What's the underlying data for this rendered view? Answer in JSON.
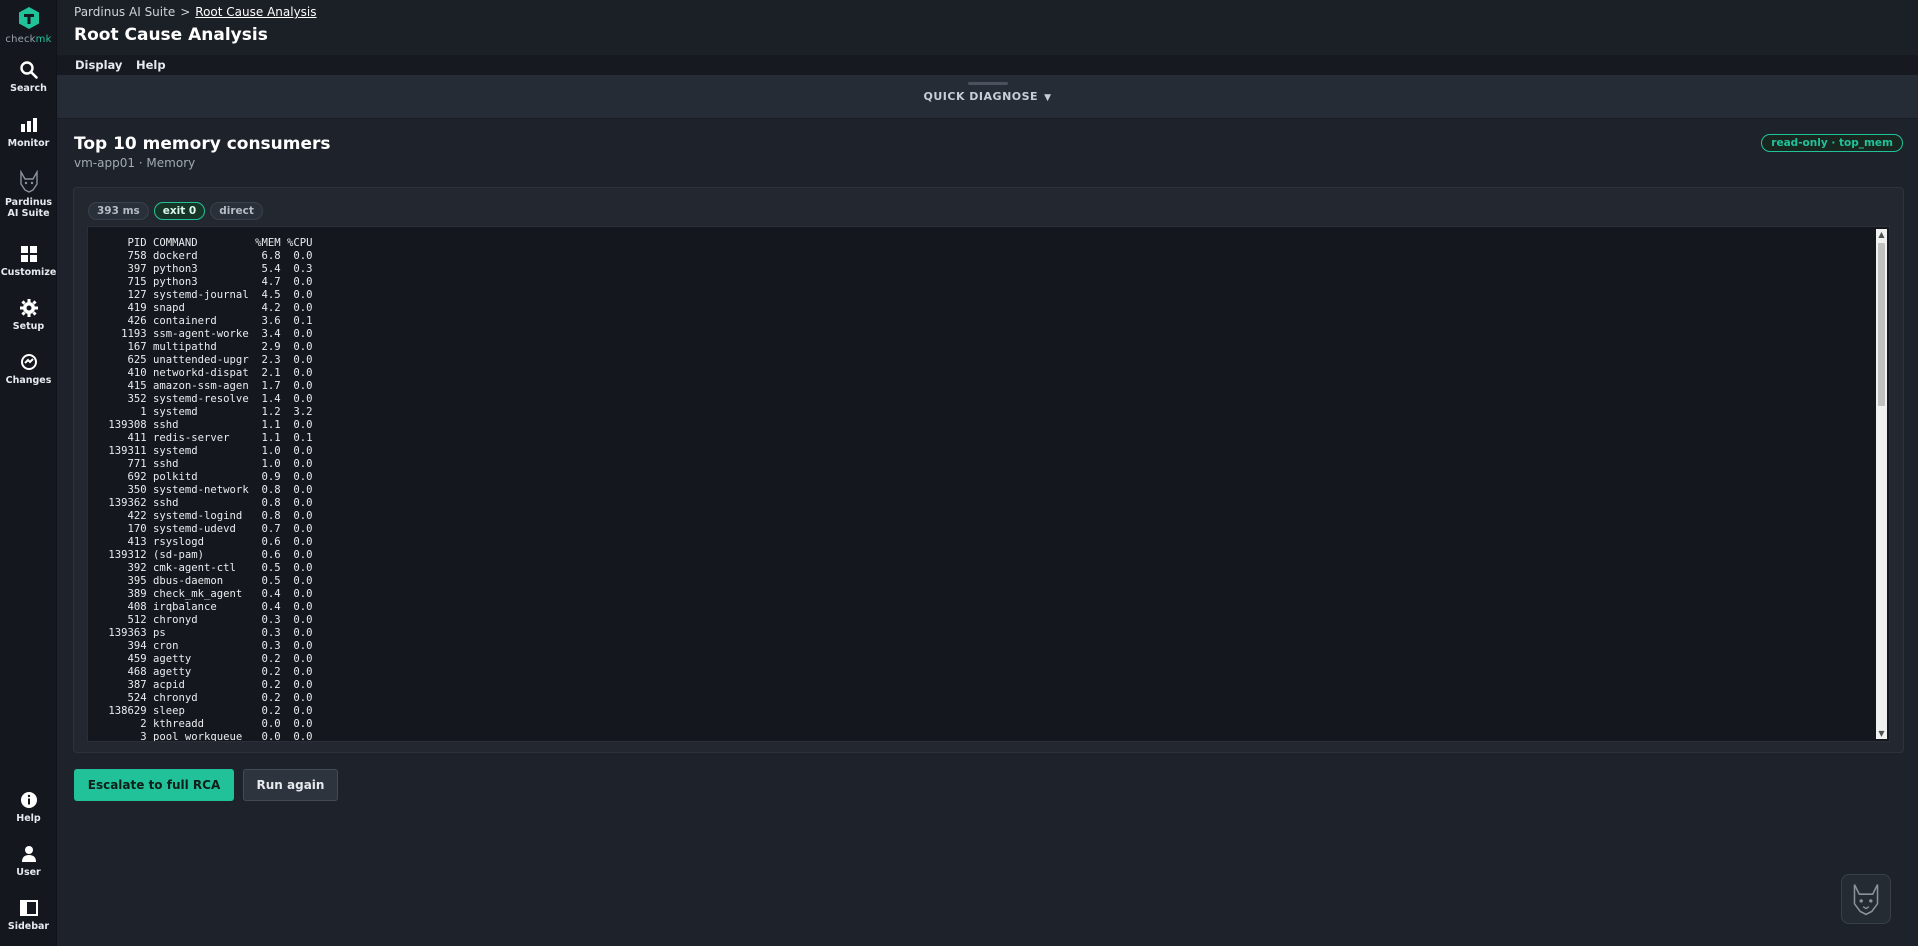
{
  "brand": {
    "part1": "check",
    "part2": "mk"
  },
  "nav": {
    "top": [
      {
        "label": "Search",
        "icon": "search-icon"
      },
      {
        "label": "Monitor",
        "icon": "monitor-icon"
      },
      {
        "label": "Pardinus AI Suite",
        "icon": "lynx-icon"
      },
      {
        "label": "Customize",
        "icon": "customize-icon"
      },
      {
        "label": "Setup",
        "icon": "gear-icon"
      },
      {
        "label": "Changes",
        "icon": "changes-icon"
      }
    ],
    "bottom": [
      {
        "label": "Help",
        "icon": "info-icon"
      },
      {
        "label": "User",
        "icon": "user-icon"
      },
      {
        "label": "Sidebar",
        "icon": "sidebar-icon"
      }
    ]
  },
  "header": {
    "breadcrumb_parent": "Pardinus AI Suite",
    "breadcrumb_sep": ">",
    "breadcrumb_current": "Root Cause Analysis",
    "title": "Root Cause Analysis"
  },
  "menu": {
    "display": "Display",
    "help": "Help"
  },
  "quick_diagnose": {
    "label": "QUICK DIAGNOSE",
    "caret": "▼"
  },
  "result": {
    "title": "Top 10 memory consumers",
    "subtitle": "vm-app01 · Memory",
    "badge": "read-only · top_mem",
    "chips": {
      "duration": "393 ms",
      "exit": "exit 0",
      "mode": "direct"
    },
    "output": "    PID COMMAND         %MEM %CPU\n    758 dockerd          6.8  0.0\n    397 python3          5.4  0.3\n    715 python3          4.7  0.0\n    127 systemd-journal  4.5  0.0\n    419 snapd            4.2  0.0\n    426 containerd       3.6  0.1\n   1193 ssm-agent-worke  3.4  0.0\n    167 multipathd       2.9  0.0\n    625 unattended-upgr  2.3  0.0\n    410 networkd-dispat  2.1  0.0\n    415 amazon-ssm-agen  1.7  0.0\n    352 systemd-resolve  1.4  0.0\n      1 systemd          1.2  3.2\n 139308 sshd             1.1  0.0\n    411 redis-server     1.1  0.1\n 139311 systemd          1.0  0.0\n    771 sshd             1.0  0.0\n    692 polkitd          0.9  0.0\n    350 systemd-network  0.8  0.0\n 139362 sshd             0.8  0.0\n    422 systemd-logind   0.8  0.0\n    170 systemd-udevd    0.7  0.0\n    413 rsyslogd         0.6  0.0\n 139312 (sd-pam)         0.6  0.0\n    392 cmk-agent-ctl    0.5  0.0\n    395 dbus-daemon      0.5  0.0\n    389 check_mk_agent   0.4  0.0\n    408 irqbalance       0.4  0.0\n    512 chronyd          0.3  0.0\n 139363 ps               0.3  0.0\n    394 cron             0.3  0.0\n    459 agetty           0.2  0.0\n    468 agetty           0.2  0.0\n    387 acpid            0.2  0.0\n    524 chronyd          0.2  0.0\n 138629 sleep            0.2  0.0\n      2 kthreadd         0.0  0.0\n      3 pool_workqueue   0.0  0.0"
  },
  "actions": {
    "escalate": "Escalate to full RCA",
    "run_again": "Run again"
  },
  "colors": {
    "accent": "#21c29a",
    "bg": "#1e232b",
    "nav_bg": "#14181e"
  }
}
